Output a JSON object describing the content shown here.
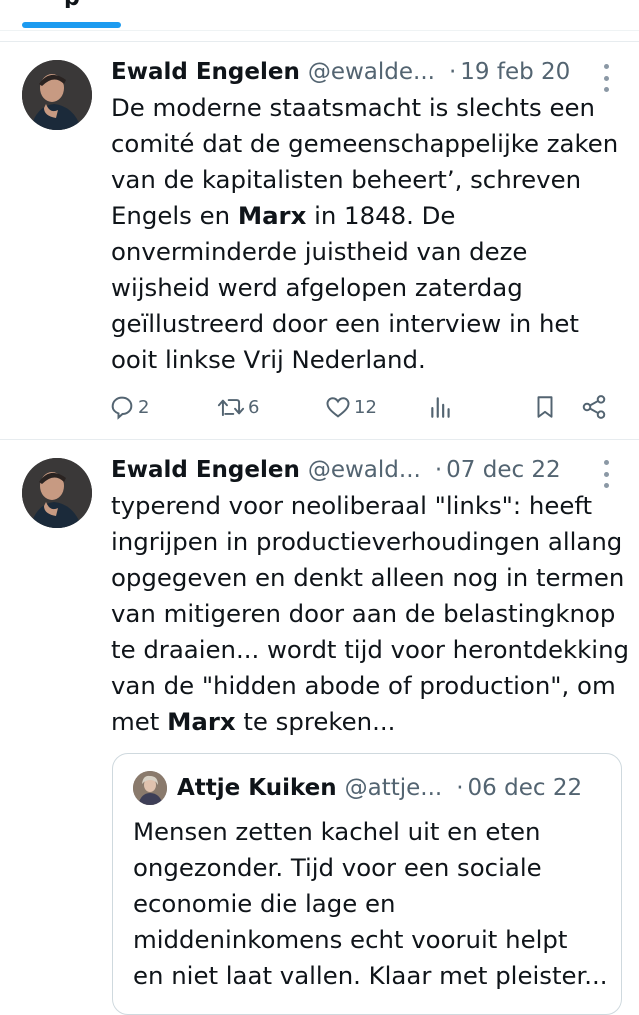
{
  "tweets": [
    {
      "author": "Ewald Engelen",
      "handle": "@ewalde...",
      "date": "19 feb 20",
      "dot": "·",
      "lines": [
        {
          "pre": "De moderne staatsmacht is slechts een",
          "bold": "",
          "post": ""
        },
        {
          "pre": "comité dat de gemeenschappelijke zaken",
          "bold": "",
          "post": ""
        },
        {
          "pre": "van de kapitalisten beheert’, schreven",
          "bold": "",
          "post": ""
        },
        {
          "pre": "Engels en ",
          "bold": "Marx",
          "post": " in 1848. De"
        },
        {
          "pre": "onverminderde juistheid van deze",
          "bold": "",
          "post": ""
        },
        {
          "pre": "wijsheid werd afgelopen zaterdag",
          "bold": "",
          "post": ""
        },
        {
          "pre": "geïllustreerd door een interview in het",
          "bold": "",
          "post": ""
        },
        {
          "pre": "ooit linkse Vrij Nederland.",
          "bold": "",
          "post": ""
        }
      ],
      "replies": "2",
      "retweets": "6",
      "likes": "12"
    },
    {
      "author": "Ewald Engelen",
      "handle": "@ewald...",
      "date": "07 dec 22",
      "dot": "·",
      "lines": [
        {
          "pre": "typerend voor neoliberaal \"links\": heeft",
          "bold": "",
          "post": ""
        },
        {
          "pre": "ingrijpen in productieverhoudingen allang",
          "bold": "",
          "post": ""
        },
        {
          "pre": "opgegeven en denkt alleen nog in termen",
          "bold": "",
          "post": ""
        },
        {
          "pre": "van mitigeren door aan de belastingknop",
          "bold": "",
          "post": ""
        },
        {
          "pre": "te draaien... wordt tijd voor herontdekking",
          "bold": "",
          "post": ""
        },
        {
          "pre": "van de \"hidden abode of production\", om",
          "bold": "",
          "post": ""
        },
        {
          "pre": "met ",
          "bold": "Marx",
          "post": " te spreken..."
        }
      ]
    }
  ],
  "quote": {
    "author": "Attje Kuiken",
    "handle": "@attje...",
    "date": "06 dec 22",
    "dot": "·",
    "lines": [
      "Mensen zetten kachel uit en eten",
      "ongezonder. Tijd voor een sociale",
      "economie die lage en",
      "middeninkomens echt vooruit helpt",
      "en niet laat vallen. Klaar met pleister..."
    ]
  },
  "colors": {
    "accent": "#1d9bf0",
    "secondary_text": "#536471",
    "primary_text": "#0f1419"
  },
  "icons": [
    "reply-icon",
    "retweet-icon",
    "like-icon",
    "views-icon",
    "bookmark-icon",
    "share-icon",
    "more-icon"
  ]
}
